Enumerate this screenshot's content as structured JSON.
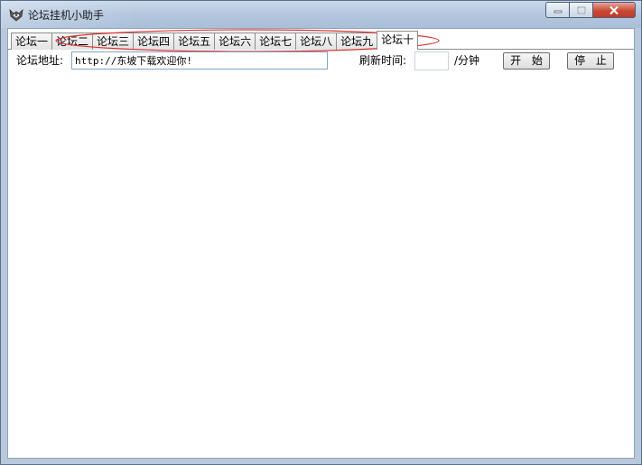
{
  "window": {
    "title": "论坛挂机小助手",
    "icon": "fox-logo-icon",
    "caption_icons": [
      "minimize-icon",
      "maximize-icon",
      "close-icon"
    ]
  },
  "tabs": [
    {
      "label": "论坛一",
      "active": false
    },
    {
      "label": "论坛二",
      "active": false
    },
    {
      "label": "论坛三",
      "active": false
    },
    {
      "label": "论坛四",
      "active": false
    },
    {
      "label": "论坛五",
      "active": false
    },
    {
      "label": "论坛六",
      "active": false
    },
    {
      "label": "论坛七",
      "active": false
    },
    {
      "label": "论坛八",
      "active": false
    },
    {
      "label": "论坛九",
      "active": false
    },
    {
      "label": "论坛十",
      "active": true
    }
  ],
  "form": {
    "url_label": "论坛地址:",
    "url_value": "http://东坡下载欢迎你!",
    "refresh_label": "刷新时间:",
    "refresh_value": "",
    "unit": "/分钟",
    "start_label": "开 始",
    "stop_label": "停 止"
  },
  "colors": {
    "highlight_ellipse": "#e03030",
    "titlebar": "#b4c7de",
    "close_button": "#c94a36"
  }
}
